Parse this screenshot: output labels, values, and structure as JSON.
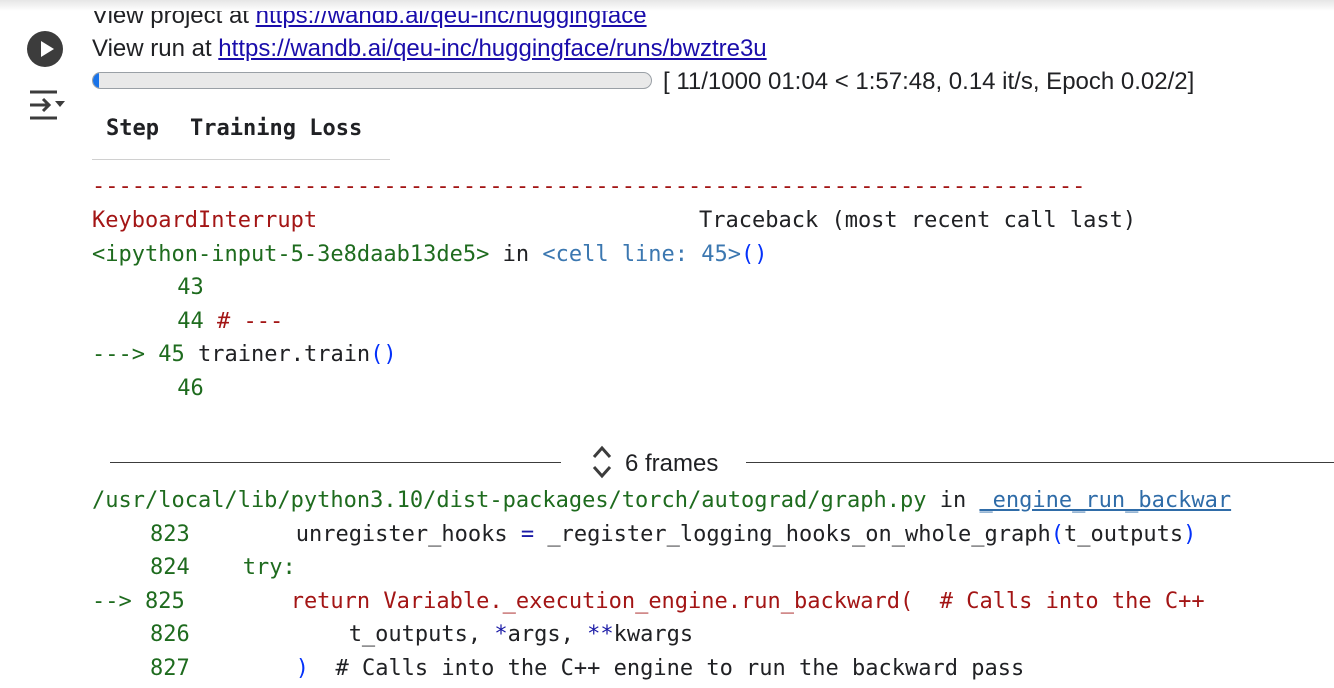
{
  "output": {
    "project_prefix": "View project at ",
    "project_url": "https://wandb.ai/qeu-inc/huggingface",
    "run_prefix": "View run at ",
    "run_url": "https://wandb.ai/qeu-inc/huggingface/runs/bwztre3u",
    "progress_fraction": 0.011,
    "progress_text": "[ 11/1000 01:04 < 1:57:48, 0.14 it/s, Epoch 0.02/2]",
    "table_headers": [
      "Step",
      "Training Loss"
    ]
  },
  "traceback": {
    "dashes": "---------------------------------------------------------------------------",
    "exception": "KeyboardInterrupt",
    "header_right": "Traceback (most recent call last)",
    "input_ref": "<ipython-input-5-3e8daab13de5>",
    "in_word": " in ",
    "cell_link": "<cell line: 45>",
    "cell_parens": "()",
    "lines": [
      {
        "arrow": "    ",
        "num": " 43",
        "code": ""
      },
      {
        "arrow": "    ",
        "num": " 44",
        "code": "# ---"
      },
      {
        "arrow": "---> ",
        "num": "45",
        "code_name": "trainer",
        "code_dot": ".",
        "code_fn": "train",
        "code_parens": "()"
      },
      {
        "arrow": "    ",
        "num": " 46",
        "code": ""
      }
    ],
    "frames_label": "6 frames",
    "file_path": "/usr/local/lib/python3.10/dist-packages/torch/autograd/graph.py",
    "file_in": " in ",
    "file_fn": "_engine_run_backwar",
    "frame_lines": {
      "l823_num": "823",
      "l823_code_a": "        unregister_hooks ",
      "l823_code_eq": "=",
      "l823_code_b": " _register_logging_hooks_on_whole_graph",
      "l823_code_p1": "(",
      "l823_code_c": "t_outputs",
      "l823_code_p2": ")",
      "l824_num": "824",
      "l824_code": "    try:",
      "l825_arrow": "--> ",
      "l825_num": "825",
      "l825_code": "        return Variable._execution_engine.run_backward(  # Calls into the C++",
      "l826_num": "826",
      "l826_code_a": "            t_outputs",
      "l826_code_b": ", ",
      "l826_code_c": "*",
      "l826_code_d": "args",
      "l826_code_e": ", ",
      "l826_code_f": "**",
      "l826_code_g": "kwargs",
      "l827_num": "827",
      "l827_code_a": "        ",
      "l827_code_p": ")",
      "l827_code_b": "  # Calls into the C++ engine to run the backward pass"
    }
  },
  "icons": {
    "run": "play-circle-icon",
    "output_options": "output-toggle-icon",
    "frames": "expand-collapse-icon"
  }
}
